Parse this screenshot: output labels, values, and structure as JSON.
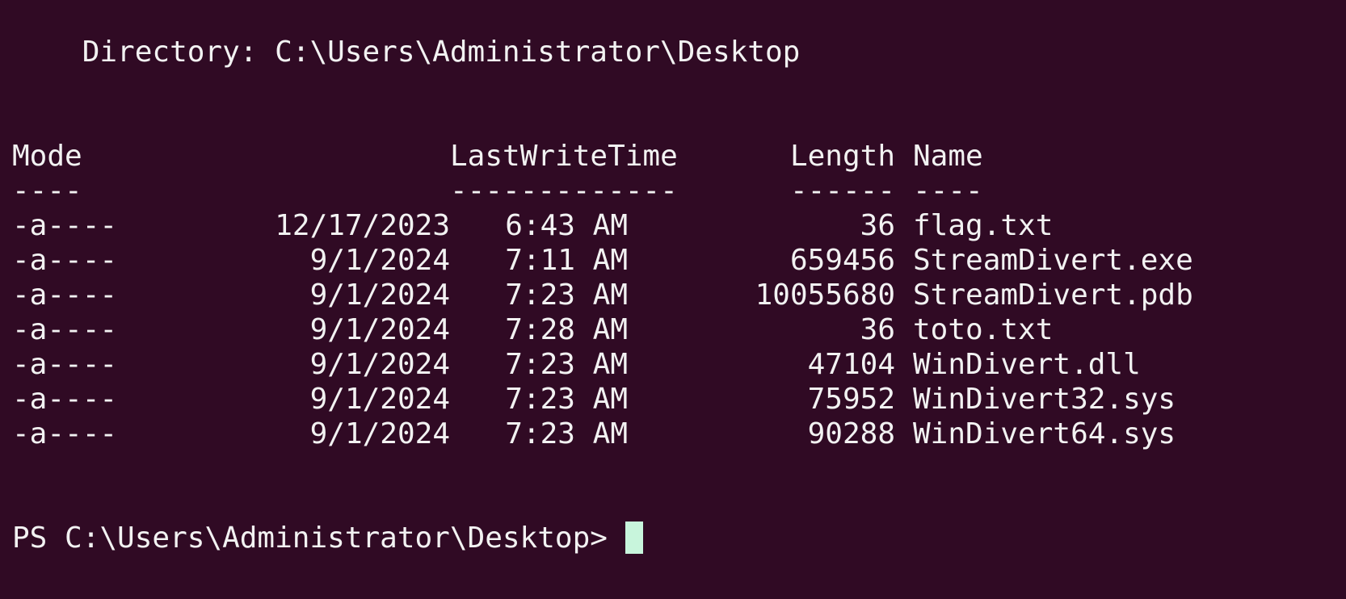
{
  "terminal": {
    "background": "#300a24",
    "foreground": "#f2f2f2",
    "cursor_color": "#c8f5dc",
    "directory_line": "    Directory: C:\\Users\\Administrator\\Desktop",
    "headers": {
      "mode": "Mode",
      "lastwritetime": "LastWriteTime",
      "length": "Length",
      "name": "Name"
    },
    "header_dashes": {
      "mode": "----",
      "lastwritetime": "-------------",
      "length": "------",
      "name": "----"
    },
    "files": [
      {
        "mode": "-a----",
        "date": "12/17/2023",
        "time": "6:43 AM",
        "length": "36",
        "name": "flag.txt"
      },
      {
        "mode": "-a----",
        "date": "9/1/2024",
        "time": "7:11 AM",
        "length": "659456",
        "name": "StreamDivert.exe"
      },
      {
        "mode": "-a----",
        "date": "9/1/2024",
        "time": "7:23 AM",
        "length": "10055680",
        "name": "StreamDivert.pdb"
      },
      {
        "mode": "-a----",
        "date": "9/1/2024",
        "time": "7:28 AM",
        "length": "36",
        "name": "toto.txt"
      },
      {
        "mode": "-a----",
        "date": "9/1/2024",
        "time": "7:23 AM",
        "length": "47104",
        "name": "WinDivert.dll"
      },
      {
        "mode": "-a----",
        "date": "9/1/2024",
        "time": "7:23 AM",
        "length": "75952",
        "name": "WinDivert32.sys"
      },
      {
        "mode": "-a----",
        "date": "9/1/2024",
        "time": "7:23 AM",
        "length": "90288",
        "name": "WinDivert64.sys"
      }
    ],
    "prompt": "PS C:\\Users\\Administrator\\Desktop>"
  }
}
